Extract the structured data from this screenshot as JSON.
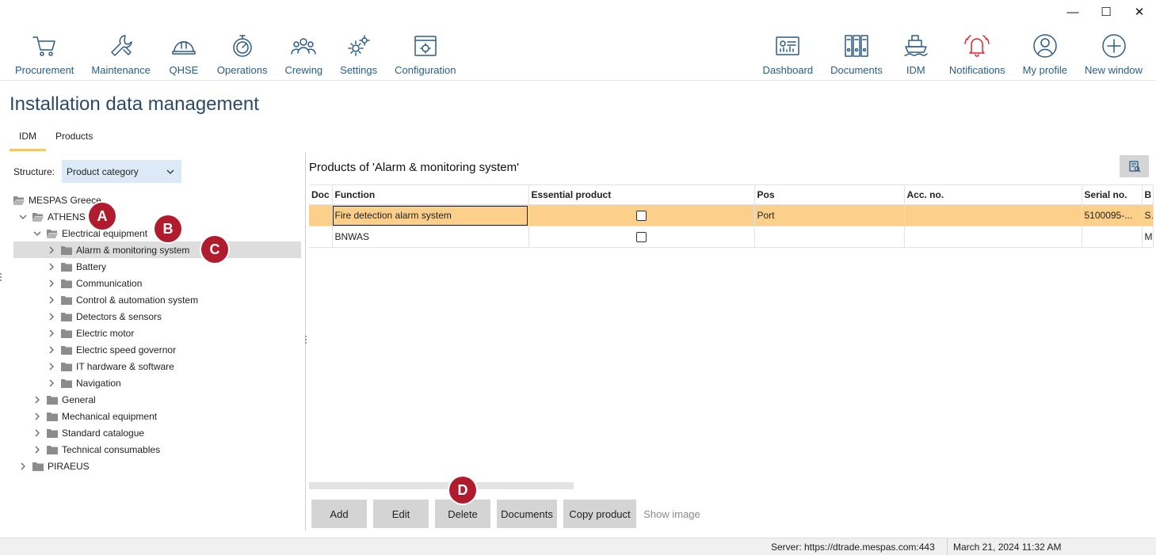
{
  "window": {
    "minimize": "—",
    "maximize": "☐",
    "close": "✕"
  },
  "toolbar": {
    "left": [
      {
        "label": "Procurement",
        "icon": "cart-icon"
      },
      {
        "label": "Maintenance",
        "icon": "wrench-icon"
      },
      {
        "label": "QHSE",
        "icon": "helmet-icon"
      },
      {
        "label": "Operations",
        "icon": "stopwatch-icon"
      },
      {
        "label": "Crewing",
        "icon": "people-icon"
      },
      {
        "label": "Settings",
        "icon": "gears-icon"
      },
      {
        "label": "Configuration",
        "icon": "config-icon"
      }
    ],
    "right": [
      {
        "label": "Dashboard",
        "icon": "dashboard-icon"
      },
      {
        "label": "Documents",
        "icon": "binders-icon"
      },
      {
        "label": "IDM",
        "icon": "ship-icon"
      },
      {
        "label": "Notifications",
        "icon": "bell-icon",
        "color": "#e0232b"
      },
      {
        "label": "My profile",
        "icon": "user-icon"
      },
      {
        "label": "New window",
        "icon": "plus-circle-icon"
      }
    ]
  },
  "page": {
    "title": "Installation data management"
  },
  "tabs": [
    {
      "label": "IDM",
      "active": true
    },
    {
      "label": "Products",
      "active": false
    }
  ],
  "structure": {
    "label": "Structure:",
    "value": "Product category"
  },
  "tree": [
    {
      "label": "MESPAS Greece",
      "level": 0,
      "chevron": "none",
      "open": true
    },
    {
      "label": "ATHENS",
      "level": 1,
      "chevron": "down",
      "open": true
    },
    {
      "label": "Electrical equipment",
      "level": 2,
      "chevron": "down",
      "open": true
    },
    {
      "label": "Alarm & monitoring system",
      "level": 3,
      "chevron": "right",
      "open": false,
      "selected": true
    },
    {
      "label": "Battery",
      "level": 3,
      "chevron": "right"
    },
    {
      "label": "Communication",
      "level": 3,
      "chevron": "right"
    },
    {
      "label": "Control & automation system",
      "level": 3,
      "chevron": "right"
    },
    {
      "label": "Detectors & sensors",
      "level": 3,
      "chevron": "right"
    },
    {
      "label": "Electric motor",
      "level": 3,
      "chevron": "right"
    },
    {
      "label": "Electric speed governor",
      "level": 3,
      "chevron": "right"
    },
    {
      "label": "IT hardware & software",
      "level": 3,
      "chevron": "right"
    },
    {
      "label": "Navigation",
      "level": 3,
      "chevron": "right"
    },
    {
      "label": "General",
      "level": 2,
      "chevron": "right"
    },
    {
      "label": "Mechanical equipment",
      "level": 2,
      "chevron": "right"
    },
    {
      "label": "Standard catalogue",
      "level": 2,
      "chevron": "right"
    },
    {
      "label": "Technical consumables",
      "level": 2,
      "chevron": "right"
    },
    {
      "label": "PIRAEUS",
      "level": 1,
      "chevron": "right"
    }
  ],
  "callouts": [
    "A",
    "B",
    "C",
    "D"
  ],
  "products": {
    "title": "Products of 'Alarm & monitoring system'",
    "columns": [
      "Doc",
      "Function",
      "Essential product",
      "Pos",
      "Acc. no.",
      "Serial no.",
      "B"
    ],
    "rows": [
      {
        "doc": "",
        "function": "Fire detection alarm system",
        "essential": false,
        "pos": "Port",
        "acc": "",
        "serial": "5100095-...",
        "b": "S",
        "selected": true
      },
      {
        "doc": "",
        "function": "BNWAS",
        "essential": false,
        "pos": "",
        "acc": "",
        "serial": "",
        "b": "M",
        "selected": false
      }
    ]
  },
  "buttons": {
    "add": "Add",
    "edit": "Edit",
    "delete": "Delete",
    "documents": "Documents",
    "copy": "Copy product",
    "show_image": "Show image"
  },
  "status": {
    "server": "Server: https://dtrade.mespas.com:443",
    "date": "March 21, 2024 11:32 AM"
  },
  "colors": {
    "accent": "#2c5c85",
    "selection": "#fcd08a",
    "callout": "#b01c2e",
    "alert": "#e0232b"
  }
}
